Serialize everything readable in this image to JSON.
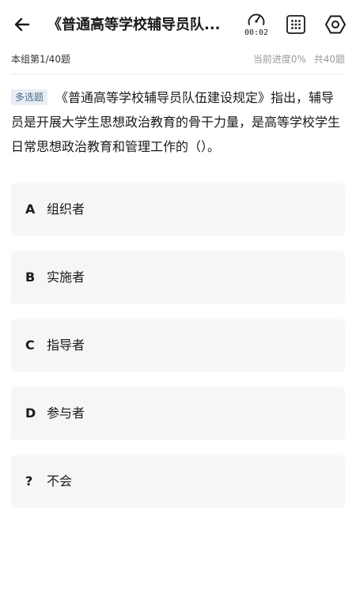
{
  "header": {
    "title": "《普通高等学校辅导员队...",
    "timer": "00:02"
  },
  "progress": {
    "group": "本组第1/40题",
    "current": "当前进度0%",
    "total": "共40题"
  },
  "question": {
    "type_badge": "多选题",
    "text": "《普通高等学校辅导员队伍建设规定》指出，辅导员是开展大学生思想政治教育的骨干力量，是高等学校学生日常思想政治教育和管理工作的（）。"
  },
  "options": [
    {
      "letter": "A",
      "text": "组织者"
    },
    {
      "letter": "B",
      "text": "实施者"
    },
    {
      "letter": "C",
      "text": "指导者"
    },
    {
      "letter": "D",
      "text": "参与者"
    },
    {
      "letter": "?",
      "text": "不会"
    }
  ]
}
